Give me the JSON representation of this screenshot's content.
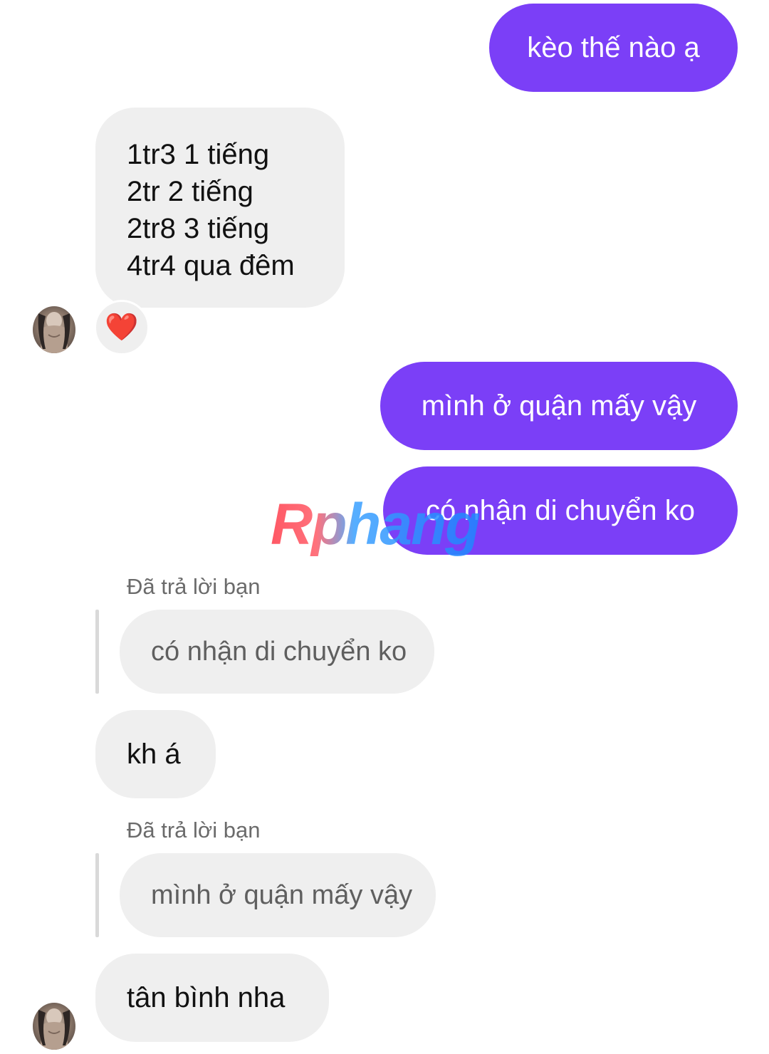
{
  "messages": {
    "sent_1": "kèo thế nào ạ",
    "recv_price_lines": [
      "1tr3 1 tiếng",
      "2tr 2 tiếng",
      "2tr8 3 tiếng",
      "4tr4 qua đêm"
    ],
    "reaction": "❤️",
    "sent_2": "mình ở quận mấy vậy",
    "sent_3": "có nhận di chuyển ko",
    "reply_1": {
      "label": "Đã trả lời bạn",
      "quoted": "có nhận di chuyển ko",
      "text": "kh á"
    },
    "reply_2": {
      "label": "Đã trả lời bạn",
      "quoted": "mình ở quận mấy vậy",
      "text": "tân bình nha"
    }
  },
  "watermark": "Rphang",
  "colors": {
    "sent_bubble": "#7b3ff7",
    "received_bubble": "#efefef",
    "background": "#ffffff"
  }
}
